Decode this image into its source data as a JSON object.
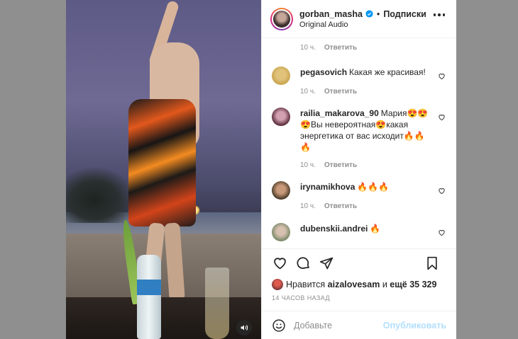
{
  "header": {
    "username": "gorban_masha",
    "follow_label": "Подписки",
    "separator": "•",
    "audio": "Original Audio",
    "verified_icon": "verified-badge-icon",
    "more_icon": "more-options-icon"
  },
  "comments": {
    "top_meta": {
      "time": "10 ч.",
      "reply": "Ответить"
    },
    "items": [
      {
        "username": "pegasovich",
        "text": "Какая же красивая!",
        "time": "10 ч.",
        "reply": "Ответить"
      },
      {
        "username": "railia_makarova_90",
        "text": "Мария😍😍😍Вы невероятная😍какая энергетика от вас исходит🔥🔥🔥",
        "time": "10 ч.",
        "reply": "Ответить"
      },
      {
        "username": "irynamikhova",
        "text": "🔥🔥🔥",
        "time": "10 ч.",
        "reply": "Ответить"
      },
      {
        "username": "dubenskii.andrei",
        "text": "🔥",
        "time": "",
        "reply": ""
      }
    ]
  },
  "actions": {
    "like_icon": "heart-icon",
    "comment_icon": "comment-icon",
    "share_icon": "share-icon",
    "save_icon": "bookmark-icon"
  },
  "likes": {
    "prefix": "Нравится",
    "user": "aizalovesam",
    "middle": "и",
    "others": "ещё 35 329"
  },
  "timestamp": "14 ЧАСОВ НАЗАД",
  "composer": {
    "emoji_icon": "emoji-icon",
    "placeholder": "Добавьте",
    "publish_label": "Опубликовать"
  },
  "media": {
    "mute_icon": "speaker-icon"
  },
  "colors": {
    "link": "#b2dffc",
    "verified": "#0095f6",
    "text": "#262626",
    "muted": "#8e8e8e"
  }
}
